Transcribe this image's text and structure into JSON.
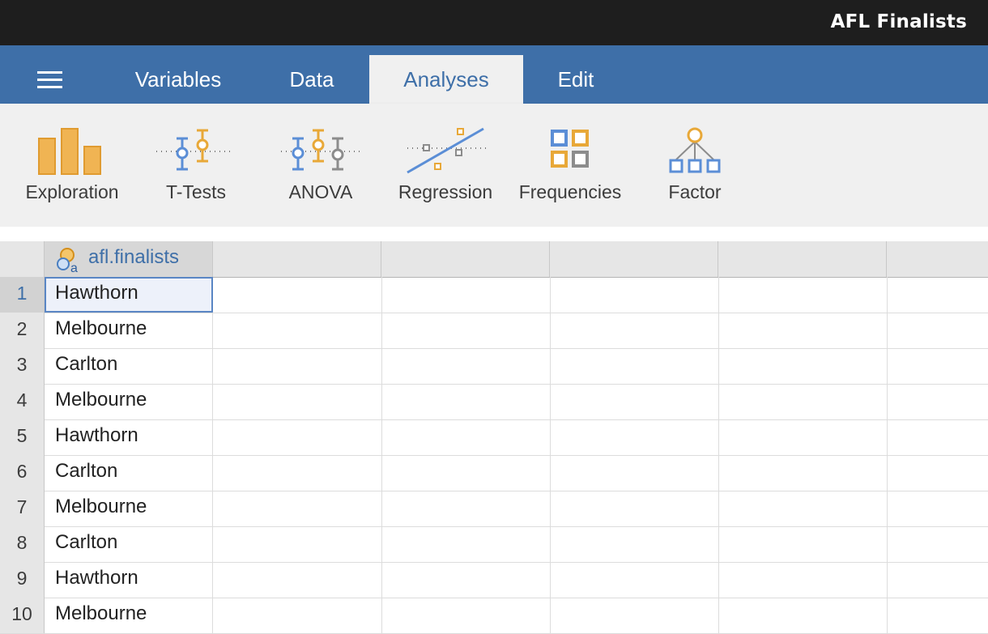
{
  "window": {
    "title": "AFL Finalists"
  },
  "tabs": [
    {
      "label": "Variables"
    },
    {
      "label": "Data"
    },
    {
      "label": "Analyses",
      "active": true
    },
    {
      "label": "Edit"
    }
  ],
  "ribbon": [
    {
      "label": "Exploration",
      "icon": "bar-chart-icon"
    },
    {
      "label": "T-Tests",
      "icon": "t-tests-icon"
    },
    {
      "label": "ANOVA",
      "icon": "anova-icon"
    },
    {
      "label": "Regression",
      "icon": "regression-icon"
    },
    {
      "label": "Frequencies",
      "icon": "frequencies-icon"
    },
    {
      "label": "Factor",
      "icon": "factor-icon"
    }
  ],
  "spreadsheet": {
    "columns": [
      {
        "name": "afl.finalists",
        "icon": "nominal-text-icon"
      }
    ],
    "rows": [
      {
        "num": "1",
        "value": "Hawthorn",
        "selected": true
      },
      {
        "num": "2",
        "value": "Melbourne"
      },
      {
        "num": "3",
        "value": "Carlton"
      },
      {
        "num": "4",
        "value": "Melbourne"
      },
      {
        "num": "5",
        "value": "Hawthorn"
      },
      {
        "num": "6",
        "value": "Carlton"
      },
      {
        "num": "7",
        "value": "Melbourne"
      },
      {
        "num": "8",
        "value": "Carlton"
      },
      {
        "num": "9",
        "value": "Hawthorn"
      },
      {
        "num": "10",
        "value": "Melbourne"
      }
    ]
  },
  "colors": {
    "accent": "#3e6fa8",
    "title_bar": "#1e1e1e",
    "icon_orange": "#e8a838",
    "icon_blue": "#5b8ed6",
    "icon_gray": "#8c8c8c"
  }
}
